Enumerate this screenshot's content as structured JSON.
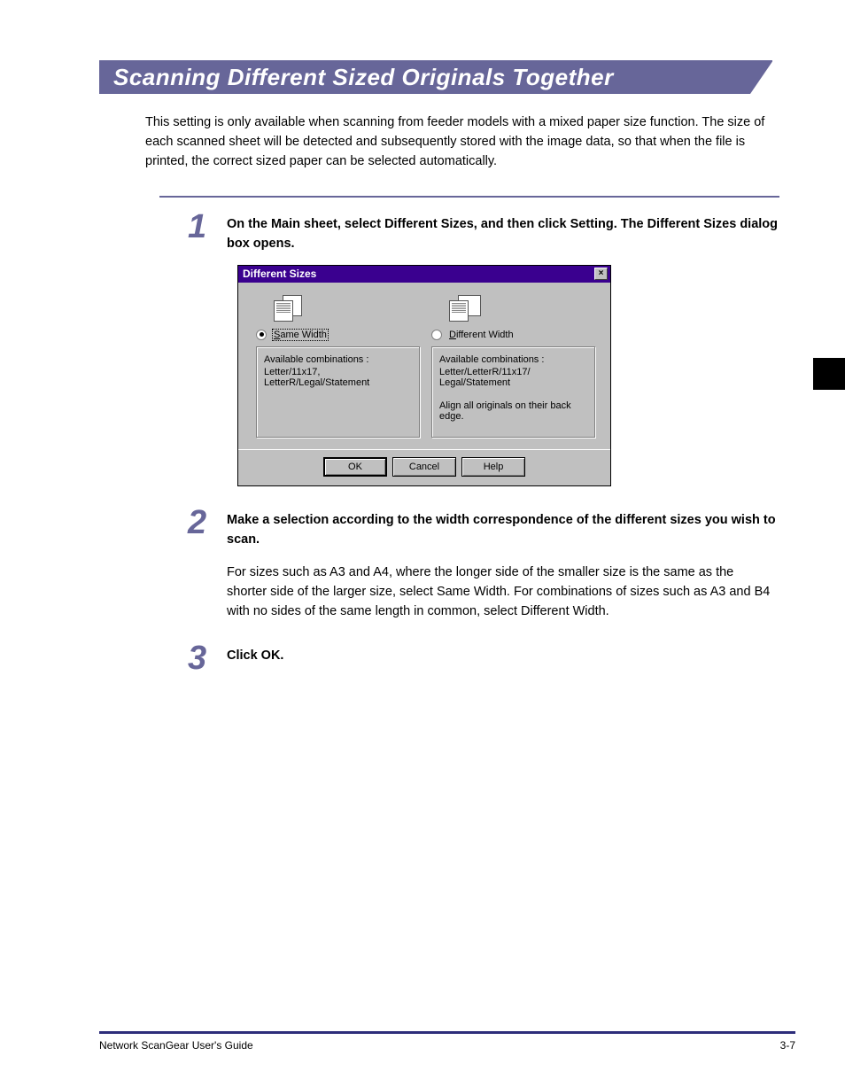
{
  "header": {
    "title": "Scanning Different Sized Originals Together"
  },
  "intro": "This setting is only available when scanning from feeder models with a mixed paper size function. The size of each scanned sheet will be detected and subsequently stored with the image data, so that when the file is printed, the correct sized paper can be selected automatically.",
  "steps": {
    "s1": {
      "num": "1",
      "text": "On the Main sheet, select Different Sizes, and then click Setting. The Different Sizes dialog box opens."
    },
    "s2": {
      "num": "2",
      "text": "Make a selection according to the width correspondence of the different sizes you wish to scan.",
      "para": "For sizes such as A3 and A4, where the longer side of the smaller size is the same as the shorter side of the larger size, select Same Width. For combinations of sizes such as A3 and B4 with no sides of the same length in common, select Different Width."
    },
    "s3": {
      "num": "3",
      "text": "Click OK."
    }
  },
  "dialog": {
    "title": "Different Sizes",
    "close": "×",
    "same": {
      "label_pre": "S",
      "label_rest": "ame Width",
      "combo_label": "Available combinations :",
      "combo_text1": "Letter/11x17,",
      "combo_text2": "LetterR/Legal/Statement"
    },
    "diff": {
      "label_pre": "D",
      "label_rest": "ifferent Width",
      "combo_label": "Available combinations :",
      "combo_text1": "Letter/LetterR/11x17/",
      "combo_text2": "Legal/Statement",
      "note1": "Align all originals on their back",
      "note2": "edge."
    },
    "buttons": {
      "ok": "OK",
      "cancel": "Cancel",
      "help": "Help"
    }
  },
  "footer": {
    "left": "Network ScanGear User's Guide",
    "right": "3-7"
  }
}
